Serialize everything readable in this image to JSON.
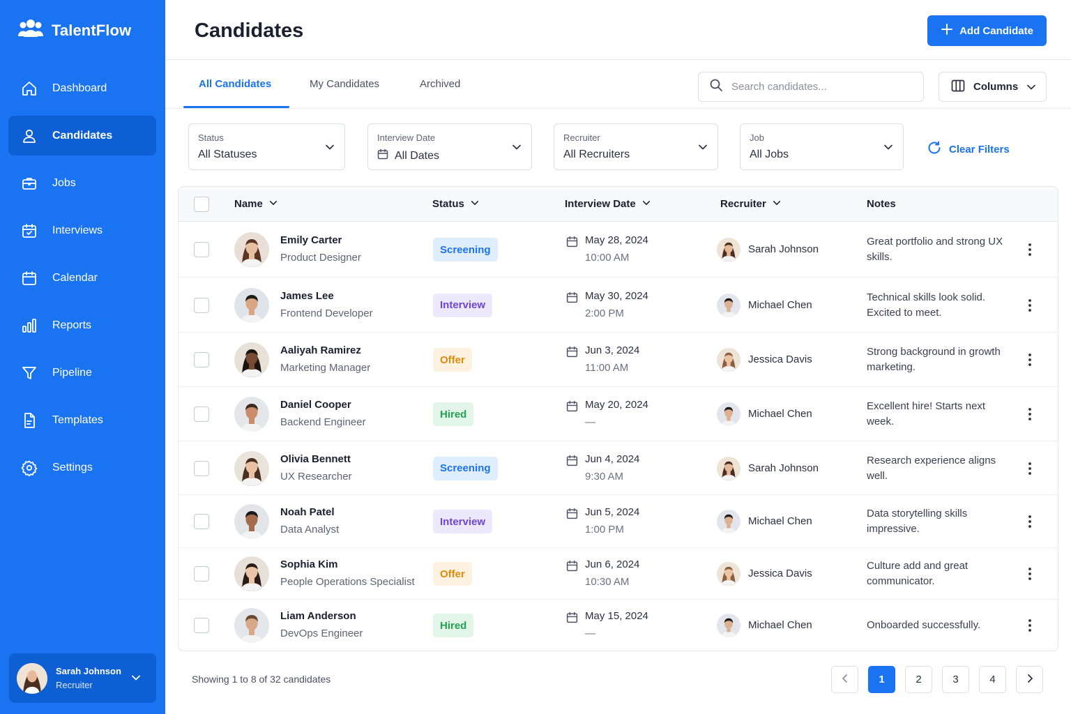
{
  "brand": {
    "name": "TalentFlow"
  },
  "nav": [
    {
      "label": "Dashboard",
      "icon": "home-icon"
    },
    {
      "label": "Candidates",
      "icon": "user-icon",
      "active": true
    },
    {
      "label": "Jobs",
      "icon": "briefcase-icon"
    },
    {
      "label": "Interviews",
      "icon": "calendar-check-icon"
    },
    {
      "label": "Calendar",
      "icon": "calendar-icon"
    },
    {
      "label": "Reports",
      "icon": "bar-chart-icon"
    },
    {
      "label": "Pipeline",
      "icon": "funnel-icon"
    },
    {
      "label": "Templates",
      "icon": "document-icon"
    },
    {
      "label": "Settings",
      "icon": "gear-icon"
    }
  ],
  "user": {
    "name": "Sarah Johnson",
    "role": "Recruiter"
  },
  "header": {
    "title": "Candidates",
    "add_label": "Add Candidate"
  },
  "tabs": [
    {
      "label": "All Candidates",
      "active": true
    },
    {
      "label": "My Candidates"
    },
    {
      "label": "Archived"
    }
  ],
  "search": {
    "placeholder": "Search candidates...",
    "value": ""
  },
  "columns_label": "Columns",
  "filters": [
    {
      "label": "Status",
      "value": "All Statuses"
    },
    {
      "label": "Interview Date",
      "value": "All Dates"
    },
    {
      "label": "Recruiter",
      "value": "All Recruiters"
    },
    {
      "label": "Job",
      "value": "All Jobs"
    }
  ],
  "clear_filters": "Clear Filters",
  "table": {
    "headers": {
      "name": "Name",
      "status": "Status",
      "date": "Interview Date",
      "recruiter": "Recruiter",
      "notes": "Notes"
    },
    "rows": [
      {
        "name": "Emily Carter",
        "role": "Product Designer",
        "status": "Screening",
        "date": "May 28, 2024",
        "time": "10:00 AM",
        "recruiter": "Sarah Johnson",
        "notes": "Great portfolio and strong UX skills."
      },
      {
        "name": "James Lee",
        "role": "Frontend Developer",
        "status": "Interview",
        "date": "May 30, 2024",
        "time": "2:00 PM",
        "recruiter": "Michael Chen",
        "notes": "Technical skills look solid. Excited to meet."
      },
      {
        "name": "Aaliyah Ramirez",
        "role": "Marketing Manager",
        "status": "Offer",
        "date": "Jun 3, 2024",
        "time": "11:00 AM",
        "recruiter": "Jessica Davis",
        "notes": "Strong background in growth marketing."
      },
      {
        "name": "Daniel Cooper",
        "role": "Backend Engineer",
        "status": "Hired",
        "date": "May 20, 2024",
        "time": "—",
        "recruiter": "Michael Chen",
        "notes": "Excellent hire! Starts next week."
      },
      {
        "name": "Olivia Bennett",
        "role": "UX Researcher",
        "status": "Screening",
        "date": "Jun 4, 2024",
        "time": "9:30 AM",
        "recruiter": "Sarah Johnson",
        "notes": "Research experience aligns well."
      },
      {
        "name": "Noah Patel",
        "role": "Data Analyst",
        "status": "Interview",
        "date": "Jun 5, 2024",
        "time": "1:00 PM",
        "recruiter": "Michael Chen",
        "notes": "Data storytelling skills impressive."
      },
      {
        "name": "Sophia Kim",
        "role": "People Operations Specialist",
        "status": "Offer",
        "date": "Jun 6, 2024",
        "time": "10:30 AM",
        "recruiter": "Jessica Davis",
        "notes": "Culture add and great communicator."
      },
      {
        "name": "Liam Anderson",
        "role": "DevOps Engineer",
        "status": "Hired",
        "date": "May 15, 2024",
        "time": "—",
        "recruiter": "Michael Chen",
        "notes": "Onboarded successfully."
      }
    ]
  },
  "pagination": {
    "summary": "Showing 1 to 8 of 32 candidates",
    "pages": [
      "1",
      "2",
      "3",
      "4"
    ],
    "current": "1"
  },
  "colors": {
    "accent": "#1a73f0",
    "sidebar": "#1a73f0",
    "sidebar_active": "#0e5ed4"
  }
}
